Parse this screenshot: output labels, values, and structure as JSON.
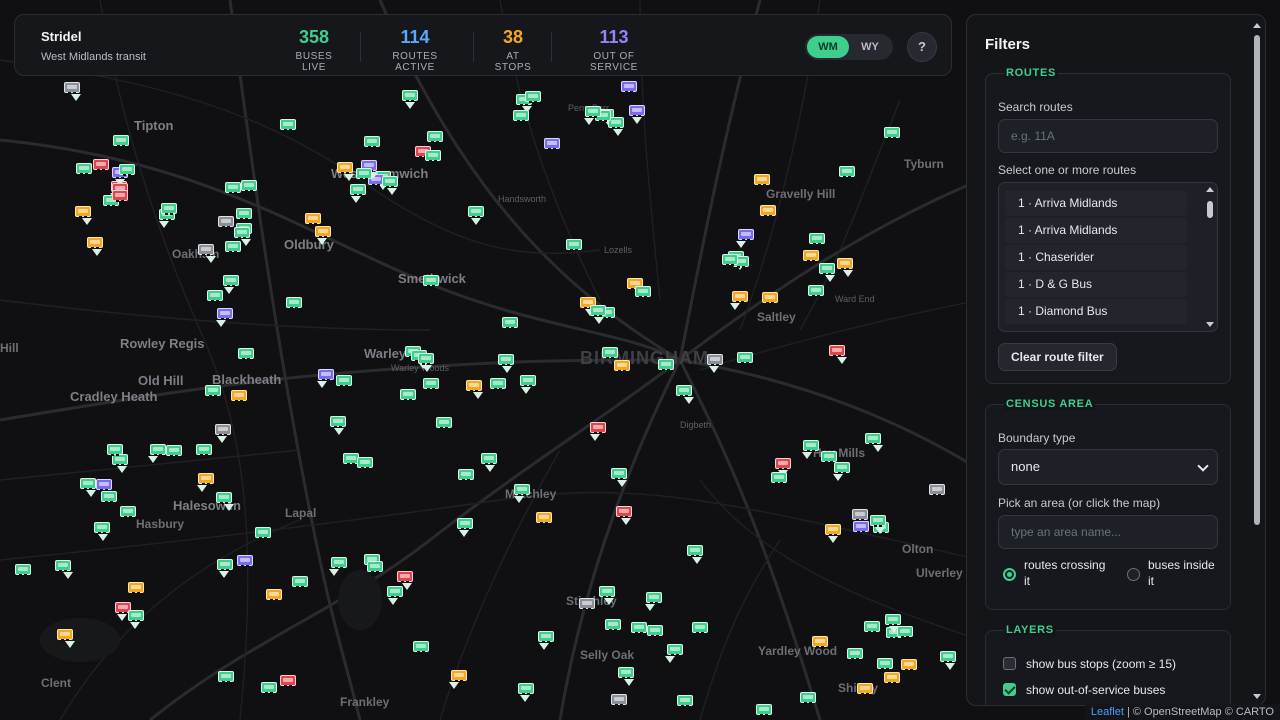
{
  "brand": {
    "name": "Stridel",
    "subtitle": "West Midlands transit"
  },
  "stats": [
    {
      "value": "358",
      "label": "BUSES LIVE",
      "color": "#3ecf8e"
    },
    {
      "value": "114",
      "label": "ROUTES ACTIVE",
      "color": "#5aa9ff"
    },
    {
      "value": "38",
      "label": "AT STOPS",
      "color": "#f3a821"
    },
    {
      "value": "113",
      "label": "OUT OF SERVICE",
      "color": "#8f86f7"
    }
  ],
  "region_toggle": {
    "active": "WM",
    "inactive": "WY"
  },
  "help_label": "?",
  "filters": {
    "title": "Filters",
    "routes": {
      "heading": "ROUTES",
      "search_label": "Search routes",
      "search_placeholder": "e.g. 11A",
      "select_label": "Select one or more routes",
      "options": [
        "1 · Arriva Midlands",
        "1 · Arriva Midlands",
        "1 · Chaserider",
        "1 · D & G Bus",
        "1 · Diamond Bus"
      ],
      "clear_label": "Clear route filter"
    },
    "census": {
      "heading": "CENSUS AREA",
      "boundary_label": "Boundary type",
      "boundary_value": "none",
      "area_label": "Pick an area (or click the map)",
      "area_placeholder": "type an area name...",
      "radio_a_1": "routes crossing",
      "radio_a_2": "it",
      "radio_b_1": "buses inside",
      "radio_b_2": "it"
    },
    "layers": {
      "heading": "LAYERS",
      "stops_label": "show bus stops (zoom ≥ 15)",
      "oos_label": "show out-of-service buses"
    }
  },
  "map_labels": [
    "Tipton",
    "West Bromwich",
    "Oldbury",
    "Oakham",
    "Smethwick",
    "Rowley Regis",
    "Old Hill",
    "Blackheath",
    "Cradley Heath",
    "Warley",
    "Warley Woods",
    "Halesowen",
    "Hasbury",
    "Lapal",
    "BIRMINGHAM",
    "Handsworth",
    "Lozells",
    "Perry Barr",
    "Gravelly Hill",
    "Tyburn",
    "Saltley",
    "Ward End",
    "Hay Mills",
    "Olton",
    "Ulverley Green",
    "Yardley Wood",
    "Stirchley",
    "Metchley",
    "Clent",
    "Frankley",
    "Hill",
    "Digbeth",
    "Shirley",
    "Selly Oak"
  ],
  "attribution": {
    "leaflet": "Leaflet",
    "rest": "| © OpenStreetMap © CARTO"
  }
}
